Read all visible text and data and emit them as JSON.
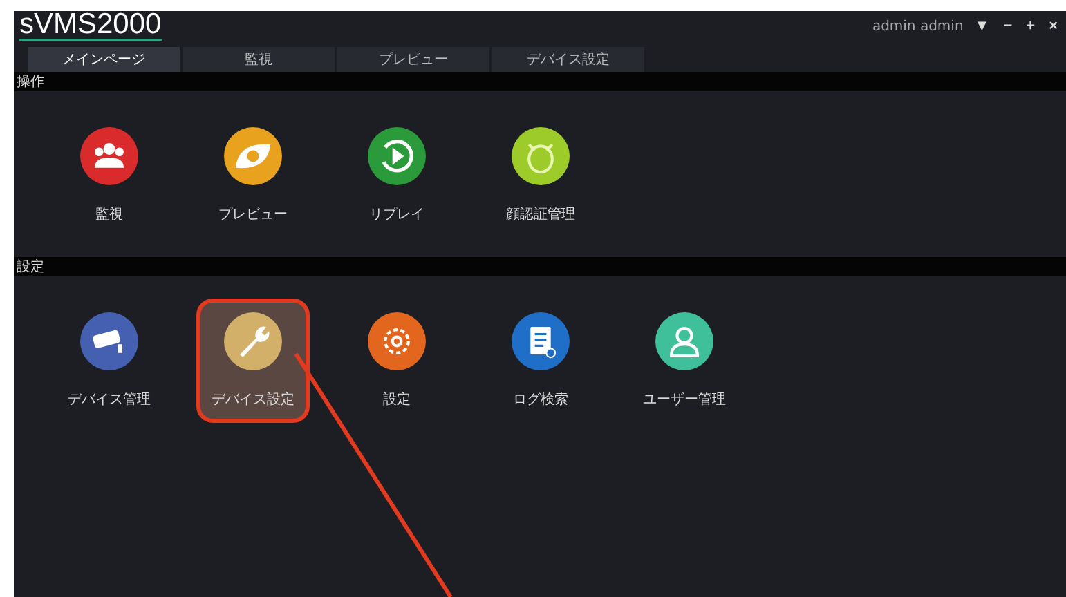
{
  "app": {
    "title": "sVMS2000",
    "user": "admin admin",
    "controls": [
      "▼",
      "−",
      "+",
      "×"
    ]
  },
  "tabs": [
    {
      "label": "メインページ",
      "selected": true
    },
    {
      "label": "監視",
      "selected": false
    },
    {
      "label": "プレビュー",
      "selected": false
    },
    {
      "label": "デバイス設定",
      "selected": false
    }
  ],
  "sections": [
    {
      "title": "操作",
      "items": [
        {
          "label": "監視",
          "kind": "people",
          "color": "#d92b2b",
          "highlighted": false
        },
        {
          "label": "プレビュー",
          "kind": "eye",
          "color": "#e8a21e",
          "highlighted": false
        },
        {
          "label": "リプレイ",
          "kind": "replay",
          "color": "#2a9a3a",
          "highlighted": false
        },
        {
          "label": "顔認証管理",
          "kind": "face",
          "color": "#9ccb2a",
          "highlighted": false
        }
      ]
    },
    {
      "title": "設定",
      "items": [
        {
          "label": "デバイス管理",
          "kind": "camera",
          "color": "#4560b0",
          "highlighted": false
        },
        {
          "label": "デバイス設定",
          "kind": "wrench",
          "color": "#d2b06a",
          "highlighted": true
        },
        {
          "label": "設定",
          "kind": "gear",
          "color": "#e2661e",
          "highlighted": false
        },
        {
          "label": "ログ検索",
          "kind": "doc",
          "color": "#1f6fc8",
          "highlighted": false
        },
        {
          "label": "ユーザー管理",
          "kind": "user",
          "color": "#3fbf9a",
          "highlighted": false
        }
      ]
    }
  ],
  "callout": {
    "pointer": true
  }
}
